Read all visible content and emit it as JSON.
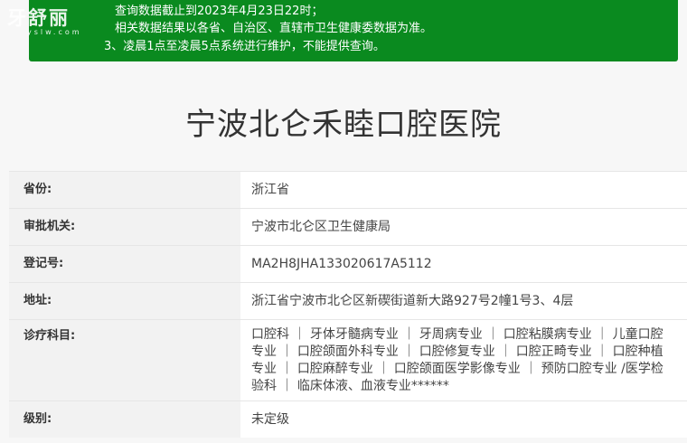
{
  "notice": {
    "line1": "查询数据截止到2023年4月23日22时；",
    "line2": "相关数据结果以各省、自治区、直辖市卫生健康委数据为准。",
    "line3": "3、凌晨1点至凌晨5点系统进行维护，不能提供查询。"
  },
  "watermark": {
    "text": "牙舒丽",
    "sub": "yslw.com"
  },
  "title": "宁波北仑禾睦口腔医院",
  "rows": [
    {
      "label": "省份:",
      "value": "浙江省"
    },
    {
      "label": "审批机关:",
      "value": "宁波市北仑区卫生健康局"
    },
    {
      "label": "登记号:",
      "value": "MA2H8JHA133020617A5112"
    },
    {
      "label": "地址:",
      "value": "浙江省宁波市北仑区新碶街道新大路927号2幢1号3、4层"
    },
    {
      "label": "诊疗科目:",
      "value": "口腔科 ｜ 牙体牙髓病专业 ｜ 牙周病专业 ｜ 口腔粘膜病专业 ｜ 儿童口腔专业 ｜ 口腔颌面外科专业 ｜ 口腔修复专业 ｜ 口腔正畸专业 ｜ 口腔种植专业 ｜ 口腔麻醉专业 ｜ 口腔颌面医学影像专业 ｜ 预防口腔专业 /医学检验科 ｜ 临床体液、血液专业******"
    },
    {
      "label": "级别:",
      "value": "未定级"
    }
  ]
}
